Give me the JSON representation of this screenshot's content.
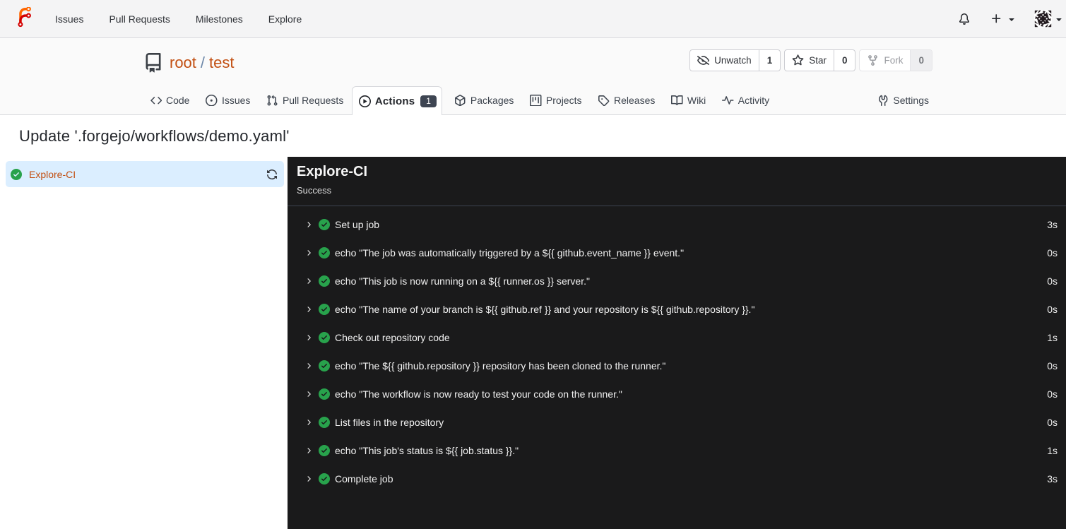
{
  "navbar": {
    "logo_icon": "forgejo-logo-icon",
    "links": [
      {
        "label": "Issues"
      },
      {
        "label": "Pull Requests"
      },
      {
        "label": "Milestones"
      },
      {
        "label": "Explore"
      }
    ],
    "notifications_icon": "bell-icon",
    "create_new_icon": "plus-icon",
    "dropdown_icon": "triangle-down-icon",
    "avatar_icon": "avatar-identicon"
  },
  "repo": {
    "icon": "repo-icon",
    "owner": "root",
    "separator": "/",
    "name": "test",
    "buttons": [
      {
        "label": "Unwatch",
        "count": "1",
        "icon": "eye-closed-icon",
        "disabled": false
      },
      {
        "label": "Star",
        "count": "0",
        "icon": "star-icon",
        "disabled": false
      },
      {
        "label": "Fork",
        "count": "0",
        "icon": "repo-forked-icon",
        "disabled": true
      }
    ],
    "tabs": [
      {
        "label": "Code",
        "icon": "code-icon"
      },
      {
        "label": "Issues",
        "icon": "issue-opened-icon"
      },
      {
        "label": "Pull Requests",
        "icon": "git-pull-request-icon"
      },
      {
        "label": "Actions",
        "icon": "play-icon",
        "active": true,
        "badge": "1"
      },
      {
        "label": "Packages",
        "icon": "package-icon"
      },
      {
        "label": "Projects",
        "icon": "project-icon"
      },
      {
        "label": "Releases",
        "icon": "tag-icon"
      },
      {
        "label": "Wiki",
        "icon": "book-icon"
      },
      {
        "label": "Activity",
        "icon": "pulse-icon"
      },
      {
        "label": "Settings",
        "icon": "tools-icon",
        "right": true
      }
    ]
  },
  "run": {
    "title": "Update '.forgejo/workflows/demo.yaml'",
    "job": {
      "name": "Explore-CI",
      "status": "Success",
      "status_icon": "check-circle-fill-icon",
      "refresh_icon": "sync-icon"
    },
    "steps": [
      {
        "name": "Set up job",
        "duration": "3s"
      },
      {
        "name": "echo \"The job was automatically triggered by a ${{ github.event_name }} event.\"",
        "duration": "0s"
      },
      {
        "name": "echo \"This job is now running on a ${{ runner.os }} server.\"",
        "duration": "0s"
      },
      {
        "name": "echo \"The name of your branch is ${{ github.ref }} and your repository is ${{ github.repository }}.\"",
        "duration": "0s"
      },
      {
        "name": "Check out repository code",
        "duration": "1s"
      },
      {
        "name": "echo \"The ${{ github.repository }} repository has been cloned to the runner.\"",
        "duration": "0s"
      },
      {
        "name": "echo \"The workflow is now ready to test your code on the runner.\"",
        "duration": "0s"
      },
      {
        "name": "List files in the repository",
        "duration": "0s"
      },
      {
        "name": "echo \"This job's status is ${{ job.status }}.\"",
        "duration": "1s"
      },
      {
        "name": "Complete job",
        "duration": "3s"
      }
    ]
  },
  "colors": {
    "primary_link": "#c24f12",
    "success_green": "#28a24c",
    "console_background": "#1a1a1b",
    "selected_job_background": "#dbeeff",
    "badge_background": "#3e4552"
  }
}
